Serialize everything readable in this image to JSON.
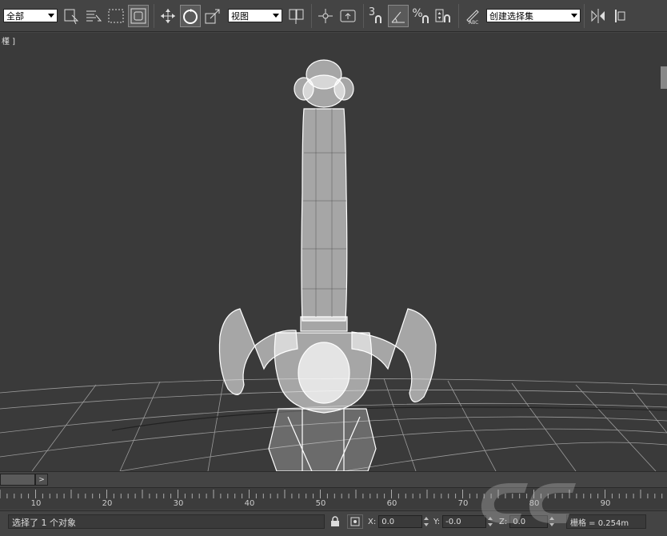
{
  "toolbar": {
    "selection_filter": "全部",
    "reference_coord": "视图",
    "spinner_snap_count": "3",
    "percent_symbol": "%",
    "named_selection_set": "创建选择集"
  },
  "viewport": {
    "label": "槿 ]"
  },
  "timeline": {
    "next_label": ">"
  },
  "ruler": {
    "ticks": [
      "10",
      "20",
      "30",
      "40",
      "50",
      "60",
      "70",
      "80",
      "90"
    ]
  },
  "status": {
    "message": "选择了 1 个对象",
    "x_label": "X:",
    "x_value": "0.0",
    "y_label": "Y:",
    "y_value": "-0.0",
    "z_label": "Z:",
    "z_value": "0.0",
    "grid_text": "栅格 = 0.254m"
  },
  "colors": {
    "bg": "#444444",
    "viewport": "#3a3a3a",
    "wire": "#ffffff"
  }
}
